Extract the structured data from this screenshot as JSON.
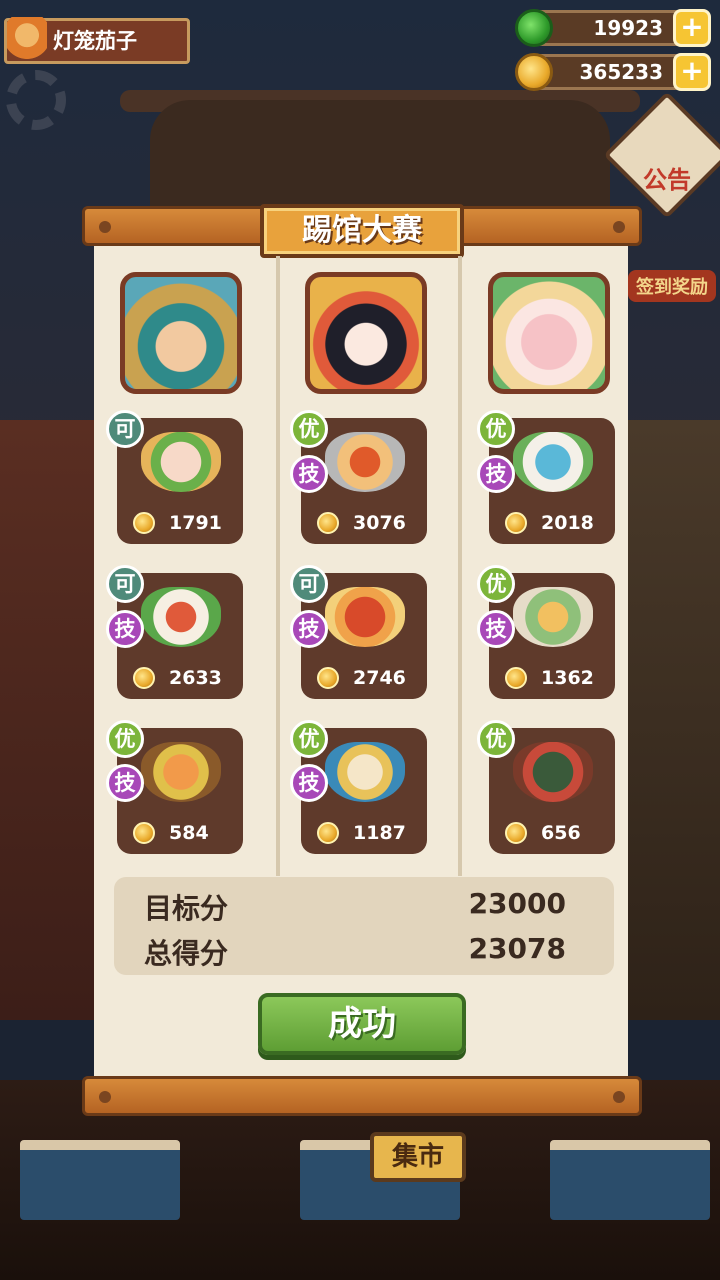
{
  "player": {
    "name": "灯笼茄子"
  },
  "currency": {
    "jade": "19923",
    "coins": "365233",
    "plus": "+"
  },
  "background": {
    "notice": "公告",
    "signin": "签到奖励",
    "market": "集市"
  },
  "dialog": {
    "title": "踢馆大赛",
    "columns": [
      {
        "dishes": [
          {
            "grade": "可",
            "skill": "",
            "price": "1791"
          },
          {
            "grade": "可",
            "skill": "技",
            "price": "2633"
          },
          {
            "grade": "优",
            "skill": "技",
            "price": "584"
          }
        ]
      },
      {
        "dishes": [
          {
            "grade": "优",
            "skill": "技",
            "price": "3076"
          },
          {
            "grade": "可",
            "skill": "技",
            "price": "2746"
          },
          {
            "grade": "优",
            "skill": "技",
            "price": "1187"
          }
        ]
      },
      {
        "dishes": [
          {
            "grade": "优",
            "skill": "技",
            "price": "2018"
          },
          {
            "grade": "优",
            "skill": "技",
            "price": "1362"
          },
          {
            "grade": "优",
            "skill": "",
            "price": "656"
          }
        ]
      }
    ],
    "target_label": "目标分",
    "target_value": "23000",
    "total_label": "总得分",
    "total_value": "23078",
    "result_button": "成功"
  }
}
